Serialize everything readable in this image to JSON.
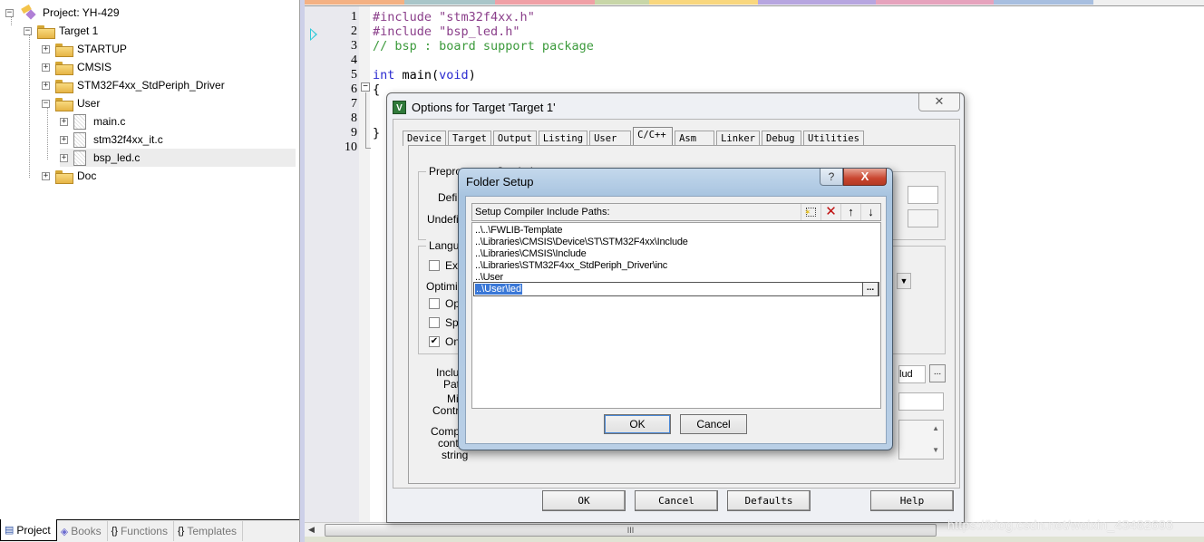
{
  "project_tree": {
    "root": "Project: YH-429",
    "target": "Target 1",
    "groups": [
      {
        "label": "STARTUP",
        "expanded": false
      },
      {
        "label": "CMSIS",
        "expanded": false
      },
      {
        "label": "STM32F4xx_StdPeriph_Driver",
        "expanded": false
      },
      {
        "label": "User",
        "expanded": true,
        "files": [
          "main.c",
          "stm32f4xx_it.c",
          "bsp_led.c"
        ]
      },
      {
        "label": "Doc",
        "expanded": false
      }
    ],
    "selected_file": "bsp_led.c"
  },
  "panel_tabs": [
    {
      "label": "Project",
      "icon": "project-icon",
      "active": true
    },
    {
      "label": "Books",
      "icon": "books-icon",
      "active": false
    },
    {
      "label": "Functions",
      "icon": "functions-icon",
      "active": false
    },
    {
      "label": "Templates",
      "icon": "templates-icon",
      "active": false
    }
  ],
  "editor": {
    "tab_colors": [
      "#f4b183",
      "#a9c6c9",
      "#f0a0a6",
      "#c8d6a8",
      "#f9d77e",
      "#b7a6e0",
      "#e6a3bd",
      "#a8bfe0"
    ],
    "line_numbers": [
      "1",
      "2",
      "3",
      "4",
      "5",
      "6",
      "7",
      "8",
      "9",
      "10"
    ],
    "lines": [
      [
        {
          "t": "#include ",
          "c": "pp"
        },
        {
          "t": "\"stm32f4xx.h\"",
          "c": "str"
        }
      ],
      [
        {
          "t": "#include ",
          "c": "pp"
        },
        {
          "t": "\"bsp_led.h\"",
          "c": "str"
        }
      ],
      [
        {
          "t": "// bsp : board support package",
          "c": "cmt"
        }
      ],
      [],
      [
        {
          "t": "int",
          "c": "kw"
        },
        {
          "t": " main(",
          "c": ""
        },
        {
          "t": "void",
          "c": "kw"
        },
        {
          "t": ")",
          "c": ""
        }
      ],
      [
        {
          "t": "{",
          "c": ""
        }
      ],
      [],
      [],
      [
        {
          "t": "}",
          "c": ""
        }
      ],
      []
    ]
  },
  "options_dialog": {
    "title": "Options for Target 'Target 1'",
    "close_label": "✕",
    "tabs": [
      "Device",
      "Target",
      "Output",
      "Listing",
      "User",
      "C/C++",
      "Asm",
      "Linker",
      "Debug",
      "Utilities"
    ],
    "active_tab": "C/C++",
    "preprocessor_group": "Preprocessor Symbols",
    "define_label": "Defin",
    "undefine_label": "Undefin",
    "language_group": "Languag",
    "exec_label": "Exec",
    "optimization_label": "Optimizat",
    "optim_label": "Optin",
    "split_label": "Split",
    "one_label": "One",
    "checkboxes": {
      "exec": false,
      "optim": false,
      "split": false,
      "one": true
    },
    "include_paths_label_1": "Include",
    "include_paths_label_2": "Paths",
    "misc_label_1": "Misc",
    "misc_label_2": "Controls",
    "compiler_label_1": "Compile",
    "compiler_label_2": "contro",
    "compiler_label_3": "string",
    "include_field_partial": "lud",
    "browse_label": "...",
    "buttons": {
      "ok": "OK",
      "cancel": "Cancel",
      "defaults": "Defaults",
      "help": "Help"
    }
  },
  "folder_setup": {
    "title": "Folder Setup",
    "help_label": "?",
    "close_label": "X",
    "header_label": "Setup Compiler Include Paths:",
    "tools": [
      {
        "name": "new-folder-icon",
        "glyph": "⬚"
      },
      {
        "name": "delete-icon",
        "glyph": "✕"
      },
      {
        "name": "move-up-icon",
        "glyph": "🡅"
      },
      {
        "name": "move-down-icon",
        "glyph": "🡇"
      }
    ],
    "paths": [
      "..\\..\\FWLIB-Template",
      "..\\Libraries\\CMSIS\\Device\\ST\\STM32F4xx\\Include",
      "..\\Libraries\\CMSIS\\Include",
      "..\\Libraries\\STM32F4xx_StdPeriph_Driver\\inc",
      "..\\User"
    ],
    "editing_value": "..\\User\\led",
    "browse_label": "...",
    "ok_label": "OK",
    "cancel_label": "Cancel"
  },
  "watermark": "https://blog.csdn.net/weixin_43482693",
  "scrollbar_grip": "III"
}
